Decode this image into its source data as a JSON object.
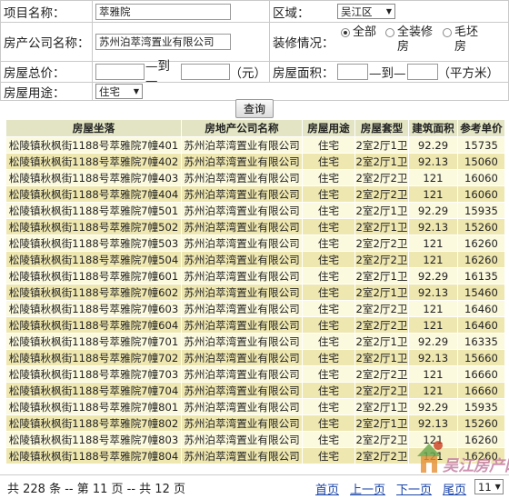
{
  "form": {
    "project_label": "项目名称：",
    "project_value": "萃雅院",
    "district_label": "区域：",
    "district_value": "吴江区",
    "company_label": "房产公司名称：",
    "company_value": "苏州泊萃湾置业有限公司",
    "decoration_label": "装修情况：",
    "decoration_options": [
      "全部",
      "全装修房",
      "毛坯房"
    ],
    "decoration_selected": "全部",
    "price_label": "房屋总价：",
    "price_sep": "—到—",
    "price_unit": "（元）",
    "area_label": "房屋面积：",
    "area_sep": "—到—",
    "area_unit": "（平方米）",
    "use_label": "房屋用途：",
    "use_value": "住宅"
  },
  "search_button": "查询",
  "table": {
    "headers": [
      "房屋坐落",
      "房地产公司名称",
      "房屋用途",
      "房屋套型",
      "建筑面积",
      "参考单价"
    ],
    "rows": [
      [
        "松陵镇秋枫街1188号萃雅院7幢401",
        "苏州泊萃湾置业有限公司",
        "住宅",
        "2室2厅1卫",
        "92.29",
        "15735"
      ],
      [
        "松陵镇秋枫街1188号萃雅院7幢402",
        "苏州泊萃湾置业有限公司",
        "住宅",
        "2室2厅1卫",
        "92.13",
        "15060"
      ],
      [
        "松陵镇秋枫街1188号萃雅院7幢403",
        "苏州泊萃湾置业有限公司",
        "住宅",
        "2室2厅2卫",
        "121",
        "16060"
      ],
      [
        "松陵镇秋枫街1188号萃雅院7幢404",
        "苏州泊萃湾置业有限公司",
        "住宅",
        "2室2厅2卫",
        "121",
        "16060"
      ],
      [
        "松陵镇秋枫街1188号萃雅院7幢501",
        "苏州泊萃湾置业有限公司",
        "住宅",
        "2室2厅1卫",
        "92.29",
        "15935"
      ],
      [
        "松陵镇秋枫街1188号萃雅院7幢502",
        "苏州泊萃湾置业有限公司",
        "住宅",
        "2室2厅1卫",
        "92.13",
        "15260"
      ],
      [
        "松陵镇秋枫街1188号萃雅院7幢503",
        "苏州泊萃湾置业有限公司",
        "住宅",
        "2室2厅2卫",
        "121",
        "16260"
      ],
      [
        "松陵镇秋枫街1188号萃雅院7幢504",
        "苏州泊萃湾置业有限公司",
        "住宅",
        "2室2厅2卫",
        "121",
        "16260"
      ],
      [
        "松陵镇秋枫街1188号萃雅院7幢601",
        "苏州泊萃湾置业有限公司",
        "住宅",
        "2室2厅1卫",
        "92.29",
        "16135"
      ],
      [
        "松陵镇秋枫街1188号萃雅院7幢602",
        "苏州泊萃湾置业有限公司",
        "住宅",
        "2室2厅1卫",
        "92.13",
        "15460"
      ],
      [
        "松陵镇秋枫街1188号萃雅院7幢603",
        "苏州泊萃湾置业有限公司",
        "住宅",
        "2室2厅2卫",
        "121",
        "16460"
      ],
      [
        "松陵镇秋枫街1188号萃雅院7幢604",
        "苏州泊萃湾置业有限公司",
        "住宅",
        "2室2厅2卫",
        "121",
        "16460"
      ],
      [
        "松陵镇秋枫街1188号萃雅院7幢701",
        "苏州泊萃湾置业有限公司",
        "住宅",
        "2室2厅1卫",
        "92.29",
        "16335"
      ],
      [
        "松陵镇秋枫街1188号萃雅院7幢702",
        "苏州泊萃湾置业有限公司",
        "住宅",
        "2室2厅1卫",
        "92.13",
        "15660"
      ],
      [
        "松陵镇秋枫街1188号萃雅院7幢703",
        "苏州泊萃湾置业有限公司",
        "住宅",
        "2室2厅2卫",
        "121",
        "16660"
      ],
      [
        "松陵镇秋枫街1188号萃雅院7幢704",
        "苏州泊萃湾置业有限公司",
        "住宅",
        "2室2厅2卫",
        "121",
        "16660"
      ],
      [
        "松陵镇秋枫街1188号萃雅院7幢801",
        "苏州泊萃湾置业有限公司",
        "住宅",
        "2室2厅1卫",
        "92.29",
        "15935"
      ],
      [
        "松陵镇秋枫街1188号萃雅院7幢802",
        "苏州泊萃湾置业有限公司",
        "住宅",
        "2室2厅1卫",
        "92.13",
        "15260"
      ],
      [
        "松陵镇秋枫街1188号萃雅院7幢803",
        "苏州泊萃湾置业有限公司",
        "住宅",
        "2室2厅2卫",
        "121",
        "16260"
      ],
      [
        "松陵镇秋枫街1188号萃雅院7幢804",
        "苏州泊萃湾置业有限公司",
        "住宅",
        "2室2厅2卫",
        "121",
        "16260"
      ]
    ]
  },
  "pagination": {
    "info": "共 228 条 -- 第 11 页 -- 共 12 页",
    "first": "首页",
    "prev": "上一页",
    "next": "下一页",
    "last": "尾页",
    "current_page": "11"
  },
  "watermark": {
    "text": "吴江房产网",
    "icon": "house-logo-icon"
  },
  "colors": {
    "header_bg": "#e2e4c3",
    "row_odd": "#fbf9de",
    "row_even": "#efe7b0",
    "link": "#1a44a8"
  }
}
